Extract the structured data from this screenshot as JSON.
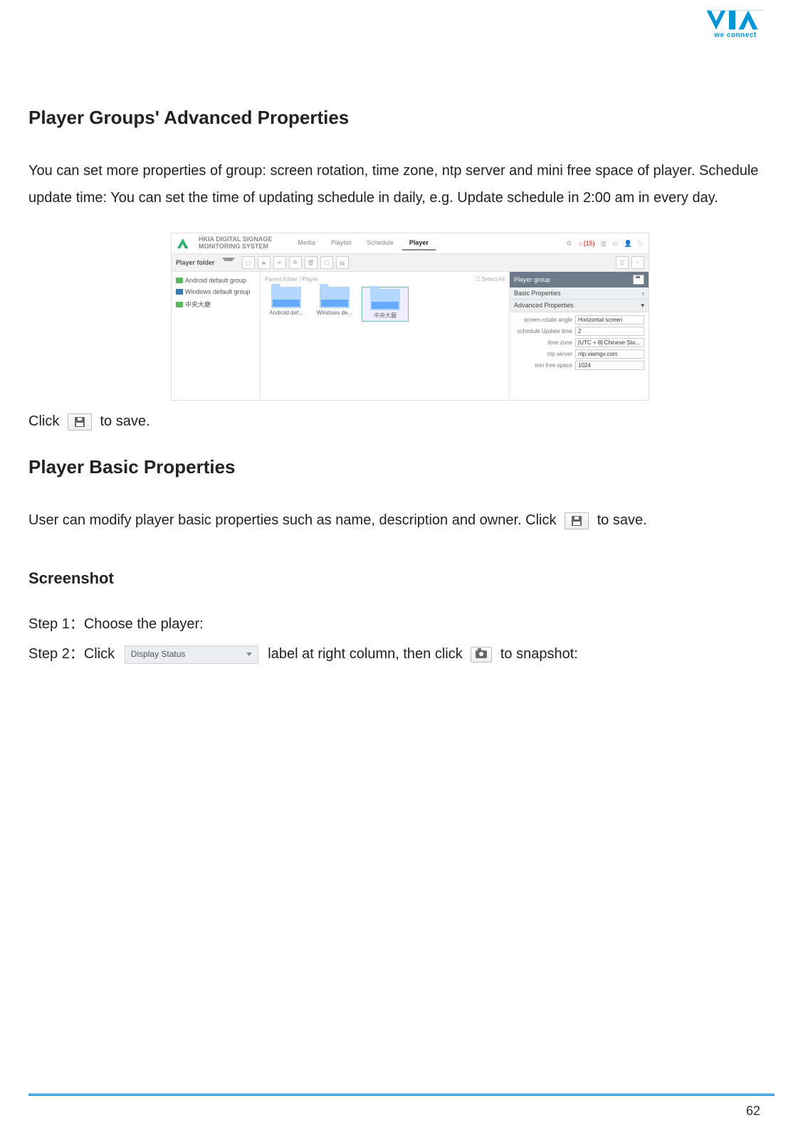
{
  "logo_tagline": "we connect",
  "heading1": "Player Groups' Advanced Properties",
  "para1": "You can set more properties of group: screen rotation, time zone, ntp server and mini free space of player. Schedule update time: You can set the time of updating schedule in daily, e.g. Update schedule in 2:00 am in every day.",
  "click_pre": "Click",
  "click_post": " to save.",
  "heading2": "Player Basic Properties",
  "para2_pre": "User can modify player basic properties such as name, description and owner. Click ",
  "para2_post": " to save.",
  "heading3": "Screenshot",
  "step1": "Step 1：Choose the player:",
  "step2_pre": "Step 2：Click ",
  "step2_mid": " label at right column, then click ",
  "step2_post": " to snapshot:",
  "display_status_label": "Display Status",
  "page_number": "62",
  "screenshot": {
    "system_title_l1": "HKIA DIGITAL SIGNAGE",
    "system_title_l2": "MONITORING SYSTEM",
    "nav": {
      "media": "Media",
      "playlist": "Playlist",
      "schedule": "Schedule",
      "player": "Player"
    },
    "alert_count": "(15)",
    "toolbar_label": "Player folder",
    "tree": {
      "item1": "Android default group",
      "item2": "Windows default group",
      "item3": "中央大廳"
    },
    "breadcrumb": "Parent folder  |  Player",
    "select_all": "Select All",
    "folders": {
      "f1": "Android def...",
      "f2": "Windows de...",
      "f3": "中央大廳"
    },
    "panel": {
      "title": "Player group",
      "basic": "Basic Properties",
      "advanced": "Advanced Properties",
      "fields": {
        "screen_rotate_label": "screen rotate angle",
        "screen_rotate_value": "Horizontal screen",
        "schedule_update_label": "schedule Update time",
        "schedule_update_value": "2",
        "time_zone_label": "time zone",
        "time_zone_value": "[UTC + 8] Chinese Stand..",
        "ntp_server_label": "ntp server",
        "ntp_server_value": "ntp.viamgv.com",
        "min_free_space_label": "min free space",
        "min_free_space_value": "1024"
      }
    }
  }
}
